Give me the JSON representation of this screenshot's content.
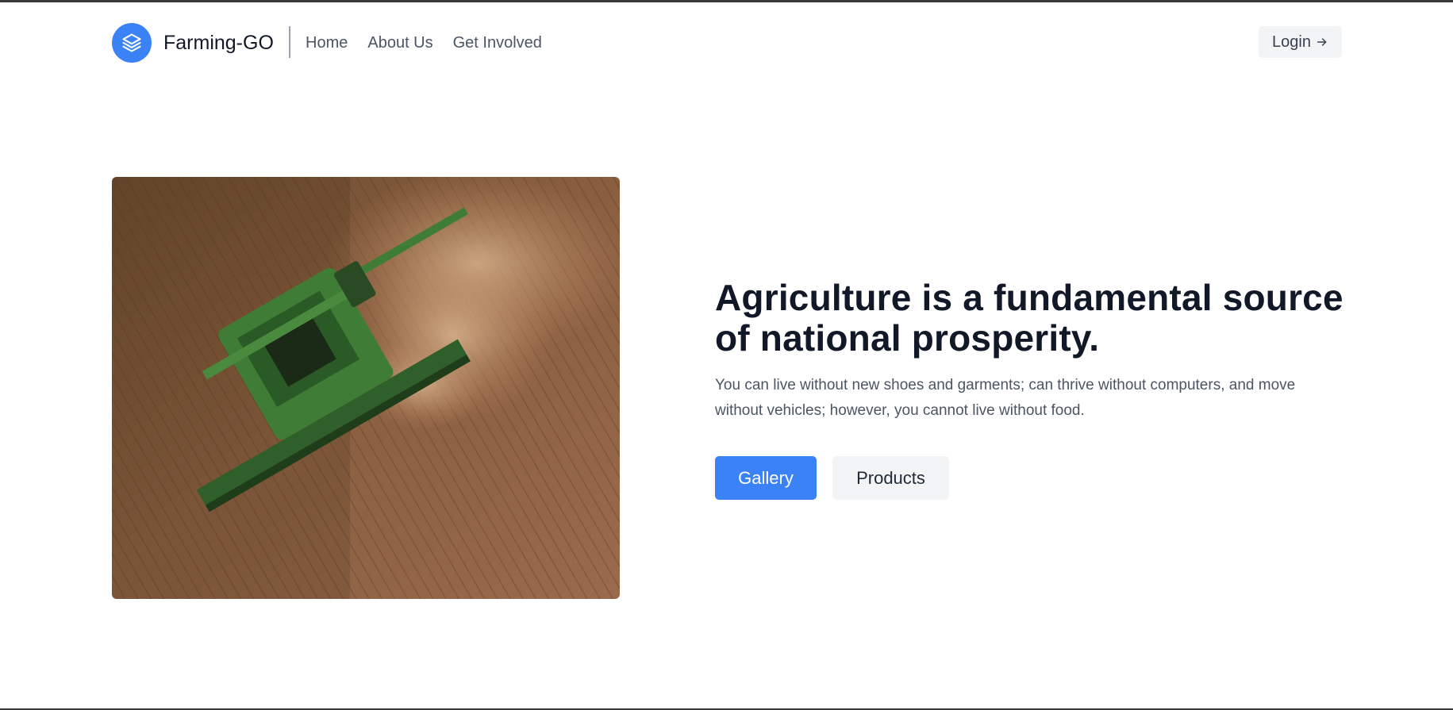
{
  "brand": {
    "name": "Farming-GO",
    "logo_icon": "layers-icon",
    "accent_color": "#3b82f6"
  },
  "nav": {
    "items": [
      {
        "label": "Home"
      },
      {
        "label": "About Us"
      },
      {
        "label": "Get Involved"
      }
    ]
  },
  "header": {
    "login_label": "Login",
    "login_icon": "arrow-right-icon"
  },
  "hero": {
    "image_alt": "Aerial view of a green combine harvester in a wheat field",
    "headline": "Agriculture is a fundamental source of national prosperity.",
    "subtext": "You can live without new shoes and garments; can thrive without computers, and move without vehicles; however, you cannot live without food.",
    "primary_button": "Gallery",
    "secondary_button": "Products"
  }
}
